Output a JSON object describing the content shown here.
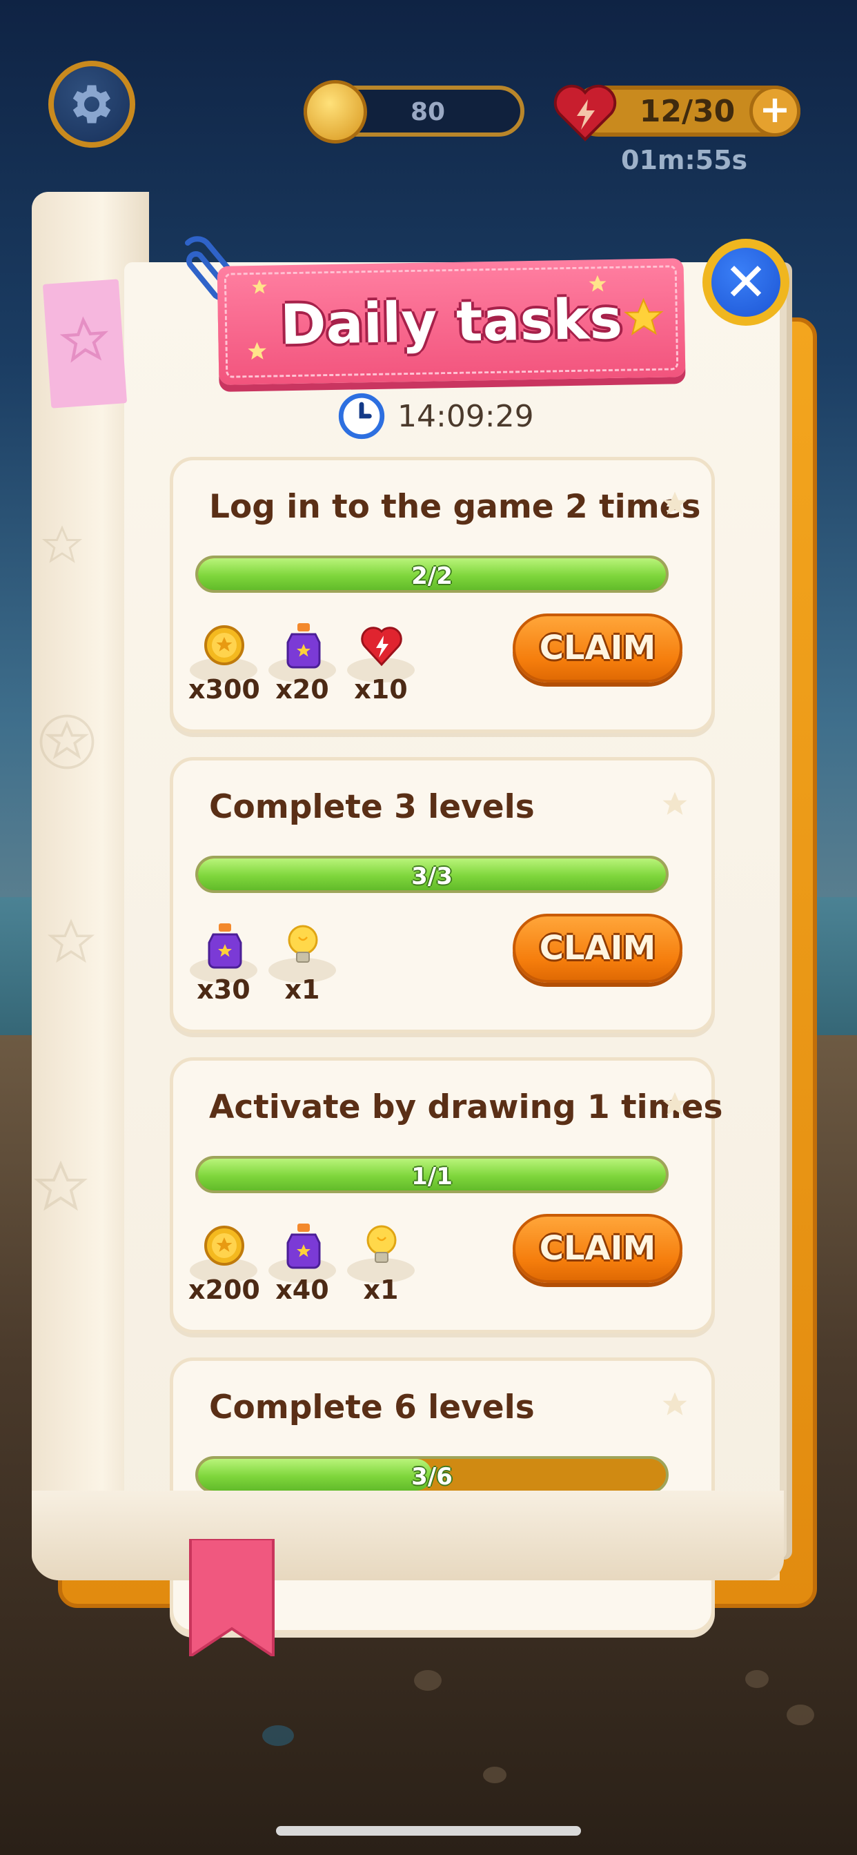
{
  "top_bar": {
    "coins": "80",
    "lives": "12/30",
    "life_timer": "01m:55s"
  },
  "header": {
    "title": "Daily tasks",
    "timer": "14:09:29"
  },
  "tasks": [
    {
      "title": "Log in to the game 2 times",
      "progress_text": "2/2",
      "progress": 1.0,
      "claim_label": "CLAIM",
      "rewards": [
        {
          "icon": "coin-icon",
          "count": "x300"
        },
        {
          "icon": "potion-icon",
          "count": "x20"
        },
        {
          "icon": "heart-bolt-icon",
          "count": "x10"
        }
      ]
    },
    {
      "title": "Complete 3 levels",
      "progress_text": "3/3",
      "progress": 1.0,
      "claim_label": "CLAIM",
      "rewards": [
        {
          "icon": "potion-icon",
          "count": "x30"
        },
        {
          "icon": "lightbulb-icon",
          "count": "x1"
        }
      ]
    },
    {
      "title": "Activate by drawing 1 times",
      "progress_text": "1/1",
      "progress": 1.0,
      "claim_label": "CLAIM",
      "rewards": [
        {
          "icon": "coin-icon",
          "count": "x200"
        },
        {
          "icon": "potion-icon",
          "count": "x40"
        },
        {
          "icon": "lightbulb-icon",
          "count": "x1"
        }
      ]
    },
    {
      "title": "Complete 6 levels",
      "progress_text": "3/6",
      "progress": 0.5
    }
  ],
  "colors": {
    "ribbon": "#f2547d",
    "claim": "#f57d0c",
    "progress_fill": "#7fd63c",
    "progress_empty": "#d08a12",
    "close_button": "#1c55d4"
  }
}
